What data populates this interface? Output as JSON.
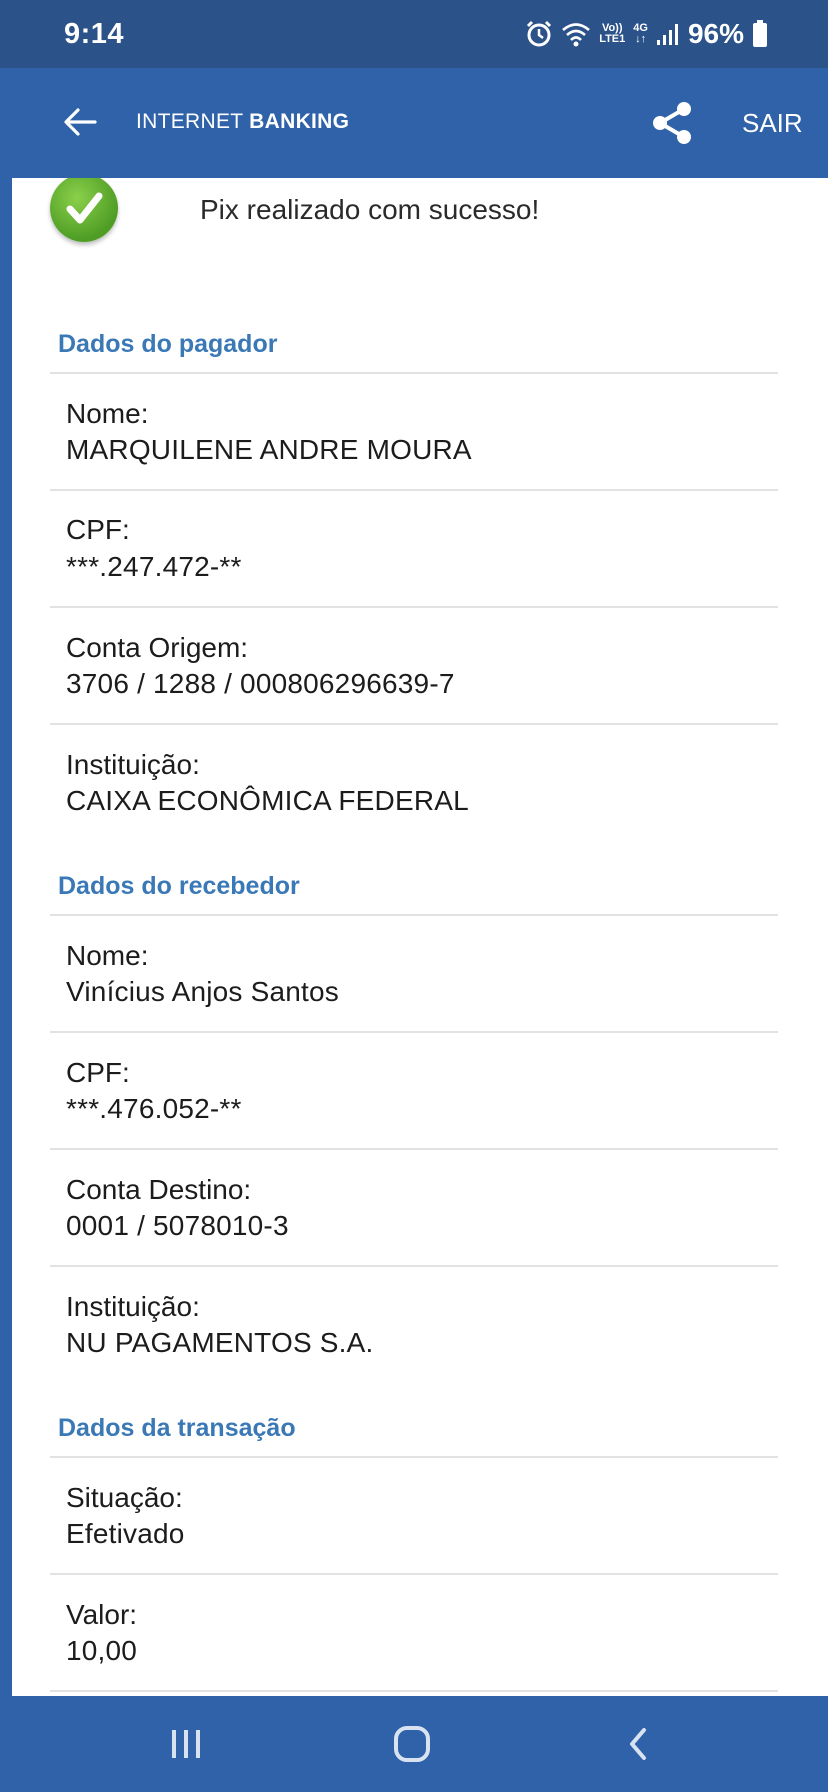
{
  "status_bar": {
    "time": "9:14",
    "volte_top": "Vo))",
    "volte_bottom": "LTE1",
    "network": "4G",
    "battery": "96%",
    "icons": [
      "alarm-icon",
      "wifi-icon",
      "signal-icon",
      "battery-icon"
    ]
  },
  "app_bar": {
    "title_regular": "INTERNET",
    "title_bold": "BANKING",
    "exit_label": "SAIR",
    "icons": [
      "back-arrow-icon",
      "share-icon"
    ]
  },
  "success_message": "Pix realizado com sucesso!",
  "sections": {
    "payer": {
      "title": "Dados do pagador",
      "fields": [
        {
          "label": "Nome:",
          "value": "MARQUILENE ANDRE MOURA"
        },
        {
          "label": "CPF:",
          "value": "***.247.472-**"
        },
        {
          "label": "Conta Origem:",
          "value": "3706 / 1288 / 000806296639-7"
        },
        {
          "label": "Instituição:",
          "value": "CAIXA ECONÔMICA FEDERAL"
        }
      ]
    },
    "receiver": {
      "title": "Dados do recebedor",
      "fields": [
        {
          "label": "Nome:",
          "value": "Vinícius Anjos Santos"
        },
        {
          "label": "CPF:",
          "value": "***.476.052-**"
        },
        {
          "label": "Conta Destino:",
          "value": "0001 / 5078010-3"
        },
        {
          "label": "Instituição:",
          "value": "NU PAGAMENTOS S.A."
        }
      ]
    },
    "transaction": {
      "title": "Dados da transação",
      "fields": [
        {
          "label": "Situação:",
          "value": "Efetivado"
        },
        {
          "label": "Valor:",
          "value": "10,00"
        }
      ]
    }
  },
  "colors": {
    "status_bar": "#2b5289",
    "app_bar": "#2f62a8",
    "section_title": "#3a78b6",
    "success_green": "#5aaa2e"
  },
  "nav_bar": {
    "icons": [
      "recent-apps-icon",
      "home-icon",
      "back-icon"
    ]
  }
}
